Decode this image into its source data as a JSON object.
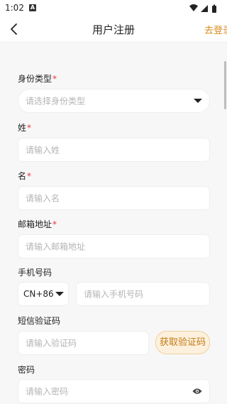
{
  "status_bar": {
    "time": "1:02",
    "notification_icon": "A"
  },
  "nav": {
    "title": "用户注册",
    "login_link": "去登录"
  },
  "form": {
    "identity_type": {
      "label": "身份类型",
      "required_mark": "*",
      "placeholder": "请选择身份类型"
    },
    "last_name": {
      "label": "姓",
      "required_mark": "*",
      "placeholder": "请输入姓"
    },
    "first_name": {
      "label": "名",
      "required_mark": "*",
      "placeholder": "请输入名"
    },
    "email": {
      "label": "邮箱地址",
      "required_mark": "*",
      "placeholder": "请输入邮箱地址"
    },
    "phone": {
      "label": "手机号码",
      "country_code": "CN+86",
      "placeholder": "请输入手机号码"
    },
    "sms_code": {
      "label": "短信验证码",
      "placeholder": "请输入验证码",
      "button": "获取验证码"
    },
    "password": {
      "label": "密码",
      "placeholder": "请输入密码"
    }
  },
  "icons": {
    "back": "chevron-left-icon",
    "wifi": "wifi-icon",
    "signal": "signal-icon",
    "battery": "battery-icon",
    "eye": "eye-icon",
    "dropdown": "caret-down-icon"
  },
  "colors": {
    "accent": "#d98c1f",
    "required": "#e53935",
    "background": "#f7f7f7"
  }
}
